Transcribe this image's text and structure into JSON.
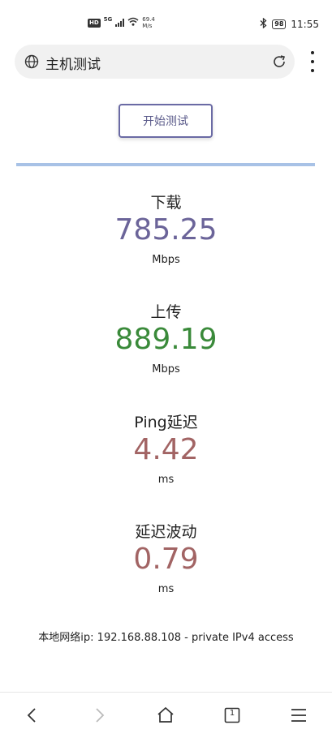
{
  "status_bar": {
    "network_badge": "HD",
    "network_type": "5G",
    "speed_value": "69.4",
    "speed_unit": "M/s",
    "battery": "98",
    "time": "11:55"
  },
  "browser": {
    "page_title": "主机测试"
  },
  "start_button_label": "开始测试",
  "metrics": {
    "download": {
      "label": "下载",
      "value": "785.25",
      "unit": "Mbps",
      "color": "#6b6499"
    },
    "upload": {
      "label": "上传",
      "value": "889.19",
      "unit": "Mbps",
      "color": "#3a8a3a"
    },
    "ping": {
      "label": "Ping延迟",
      "value": "4.42",
      "unit": "ms",
      "color": "#a26464"
    },
    "jitter": {
      "label": "延迟波动",
      "value": "0.79",
      "unit": "ms",
      "color": "#a26464"
    }
  },
  "local_ip_text": "本地网络ip: 192.168.88.108 - private IPv4 access",
  "bottom_nav": {
    "tab_count": "1",
    "icons": [
      "back-icon",
      "forward-icon",
      "home-icon",
      "tabs-icon",
      "menu-icon"
    ]
  }
}
